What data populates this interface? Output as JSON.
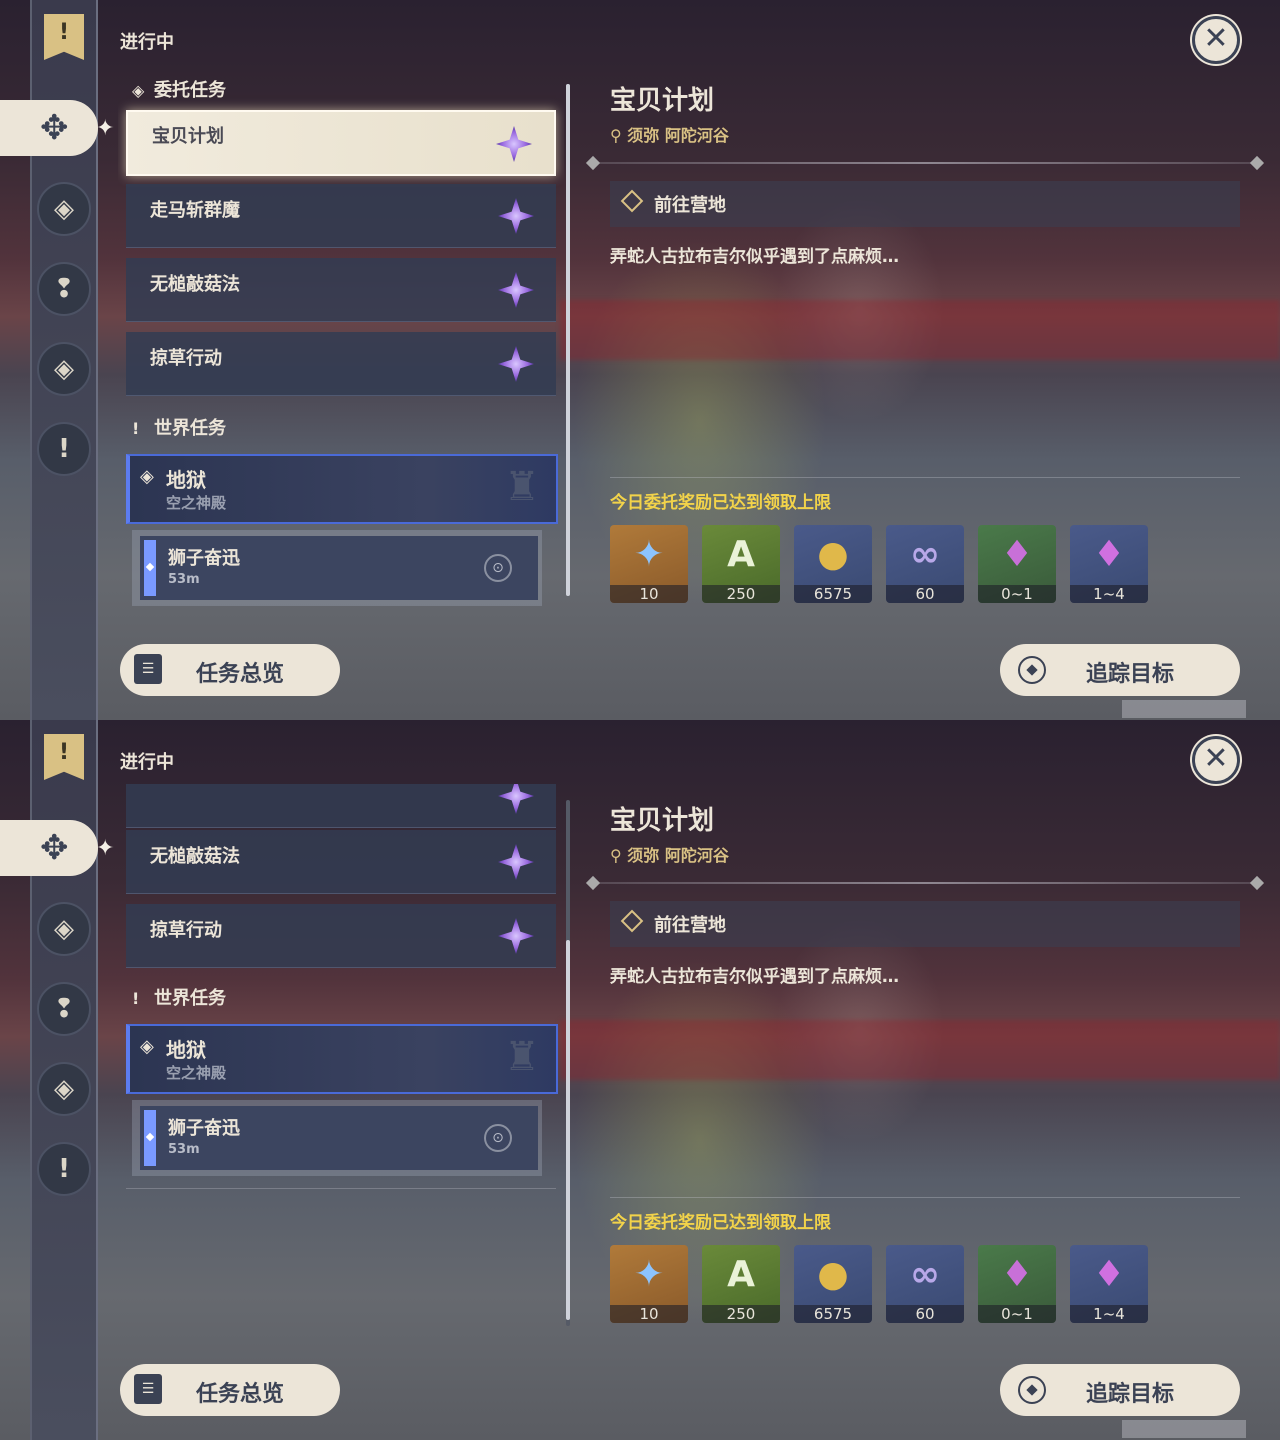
{
  "panels": [
    {
      "header": "进行中",
      "categories": {
        "commissions": "委托任务",
        "world": "世界任务"
      },
      "commission_quests": [
        "宝贝计划",
        "走马斩群魔",
        "无槌敲菇法",
        "掠草行动"
      ],
      "world_quest": {
        "title": "地狱",
        "subtitle": "空之神殿"
      },
      "sub_quest": {
        "title": "狮子奋迅",
        "distance": "53m"
      },
      "overview_label": "任务总览",
      "detail": {
        "title": "宝贝计划",
        "location": "须弥 阿陀河谷",
        "objective": "前往营地",
        "description": "弄蛇人古拉布吉尔似乎遇到了点麻烦…",
        "reward_note": "今日委托奖励已达到领取上限",
        "rewards": [
          "10",
          "250",
          "6575",
          "60",
          "0~1",
          "1~4"
        ]
      },
      "track_label": "追踪目标"
    },
    {
      "header": "进行中",
      "categories": {
        "world": "世界任务"
      },
      "commission_quests": [
        "无槌敲菇法",
        "掠草行动"
      ],
      "world_quest": {
        "title": "地狱",
        "subtitle": "空之神殿"
      },
      "sub_quest": {
        "title": "狮子奋迅",
        "distance": "53m"
      },
      "overview_label": "任务总览",
      "detail": {
        "title": "宝贝计划",
        "location": "须弥 阿陀河谷",
        "objective": "前往营地",
        "description": "弄蛇人古拉布吉尔似乎遇到了点麻烦…",
        "reward_note": "今日委托奖励已达到领取上限",
        "rewards": [
          "10",
          "250",
          "6575",
          "60",
          "0~1",
          "1~4"
        ]
      },
      "track_label": "追踪目标"
    }
  ],
  "icons": {
    "close": "close-icon",
    "banner": "quest-banner-icon",
    "commission": "commission-icon",
    "reward_items": [
      "primogem-icon",
      "adventure-exp-icon",
      "mora-icon",
      "friendship-exp-icon",
      "crystal-ore-icon",
      "gem-shard-icon"
    ]
  },
  "colors": {
    "accent": "#ece5d8",
    "reward_note": "#f2d34a",
    "location": "#d9c184",
    "world_quest_border": "#4a6ad8"
  }
}
